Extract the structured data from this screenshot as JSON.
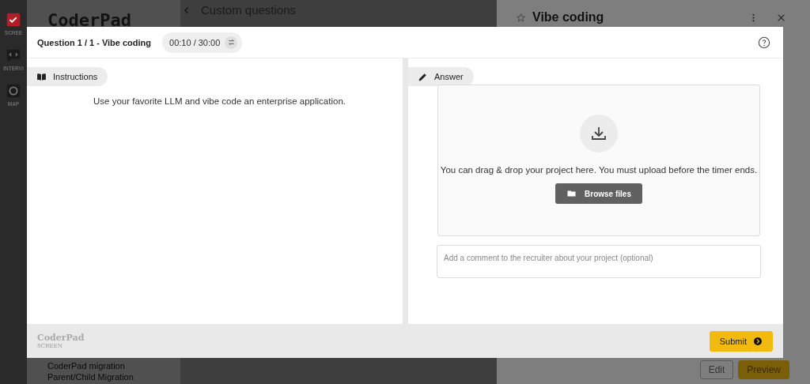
{
  "background": {
    "sidebar": [
      {
        "kind": "screen",
        "label": "SCREE",
        "selected": true
      },
      {
        "kind": "interview",
        "label": "INTERVI",
        "selected": false
      },
      {
        "kind": "map",
        "label": "MAP",
        "selected": false
      }
    ],
    "logo": "CoderPad",
    "list_items": [
      "CoderPad migration",
      "Parent/Child Migration"
    ],
    "page_title": "Custom questions",
    "drawer": {
      "title": "Vibe coding",
      "buttons": [
        "Edit",
        "Preview"
      ]
    }
  },
  "modal": {
    "title": "Question 1 / 1 - Vibe coding",
    "timer": "00:10 / 30:00",
    "instructions": {
      "tab": "Instructions",
      "text": "Use your favorite LLM and vibe code an enterprise application."
    },
    "answer": {
      "tab": "Answer",
      "drop_text": "You can drag & drop your project here. You must upload before the timer ends.",
      "browse_button": "Browse files",
      "comment_placeholder": "Add a comment to the recruiter about your project (optional)"
    },
    "footer": {
      "logo": "CoderPad",
      "logo_sub": "SCREEN",
      "submit": "Submit"
    }
  }
}
